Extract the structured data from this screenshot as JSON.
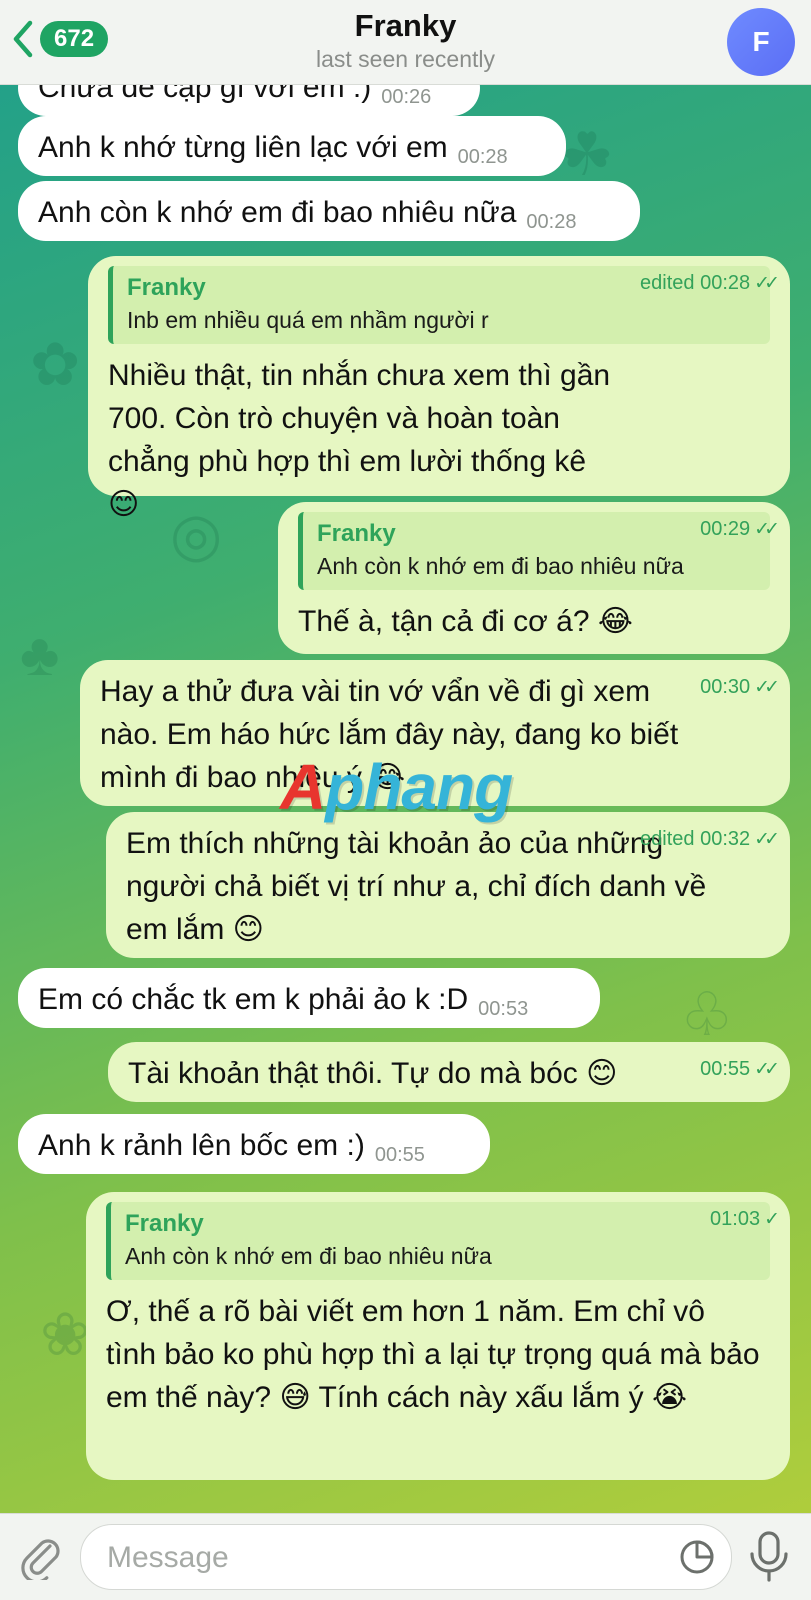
{
  "header": {
    "back_count": "672",
    "title": "Franky",
    "subtitle": "last seen recently",
    "avatar_letter": "F"
  },
  "messages": [
    {
      "dir": "in",
      "text": "Chưa đề cập gì với em :)",
      "time": "00:26"
    },
    {
      "dir": "in",
      "text": "Anh k nhớ từng liên lạc với em",
      "time": "00:28"
    },
    {
      "dir": "in",
      "text": "Anh còn k nhớ em đi bao nhiêu nữa",
      "time": "00:28"
    },
    {
      "dir": "out",
      "reply_name": "Franky",
      "reply_text": "Inb em nhiều quá em nhầm người r",
      "text": "Nhiều thật, tin nhắn chưa xem thì gần 700. Còn trò chuyện và hoàn toàn chẳng phù hợp thì em lười thống kê 😊",
      "time": "edited 00:28"
    },
    {
      "dir": "out",
      "reply_name": "Franky",
      "reply_text": "Anh còn k nhớ em đi bao nhiêu nữa",
      "text": "Thế à, tận cả đi cơ á? 😂",
      "time": "00:29"
    },
    {
      "dir": "out",
      "text": "Hay a thử đưa vài tin vớ vẩn về đi gì xem nào. Em háo hức lắm đây này, đang ko biết mình đi bao nhiêu ý 😂",
      "time": "00:30"
    },
    {
      "dir": "out",
      "text": "Em thích những tài khoản ảo của những người chả biết vị trí như a, chỉ đích danh về em lắm 😊",
      "time": "edited 00:32"
    },
    {
      "dir": "in",
      "text": "Em có chắc tk em k phải ảo k :D",
      "time": "00:53"
    },
    {
      "dir": "out",
      "text": "Tài khoản thật thôi. Tự do mà bóc 😊",
      "time": "00:55"
    },
    {
      "dir": "in",
      "text": "Anh k rảnh lên bốc em :)",
      "time": "00:55"
    },
    {
      "dir": "out",
      "reply_name": "Franky",
      "reply_text": "Anh còn k nhớ em đi bao nhiêu nữa",
      "text": "Ơ, thế a rõ bài viết em hơn 1 năm. Em chỉ vô tình bảo ko phù hợp thì a lại tự trọng quá mà bảo em thế này? 😅 Tính cách này xấu lắm ý 😭",
      "time": "01:03"
    }
  ],
  "watermark": {
    "prefix": "A",
    "rest": "phang"
  },
  "input": {
    "placeholder": "Message"
  },
  "colors": {
    "accent": "#1fa463",
    "outgoing_bubble": "#e6f7c2",
    "incoming_bubble": "#ffffff"
  }
}
